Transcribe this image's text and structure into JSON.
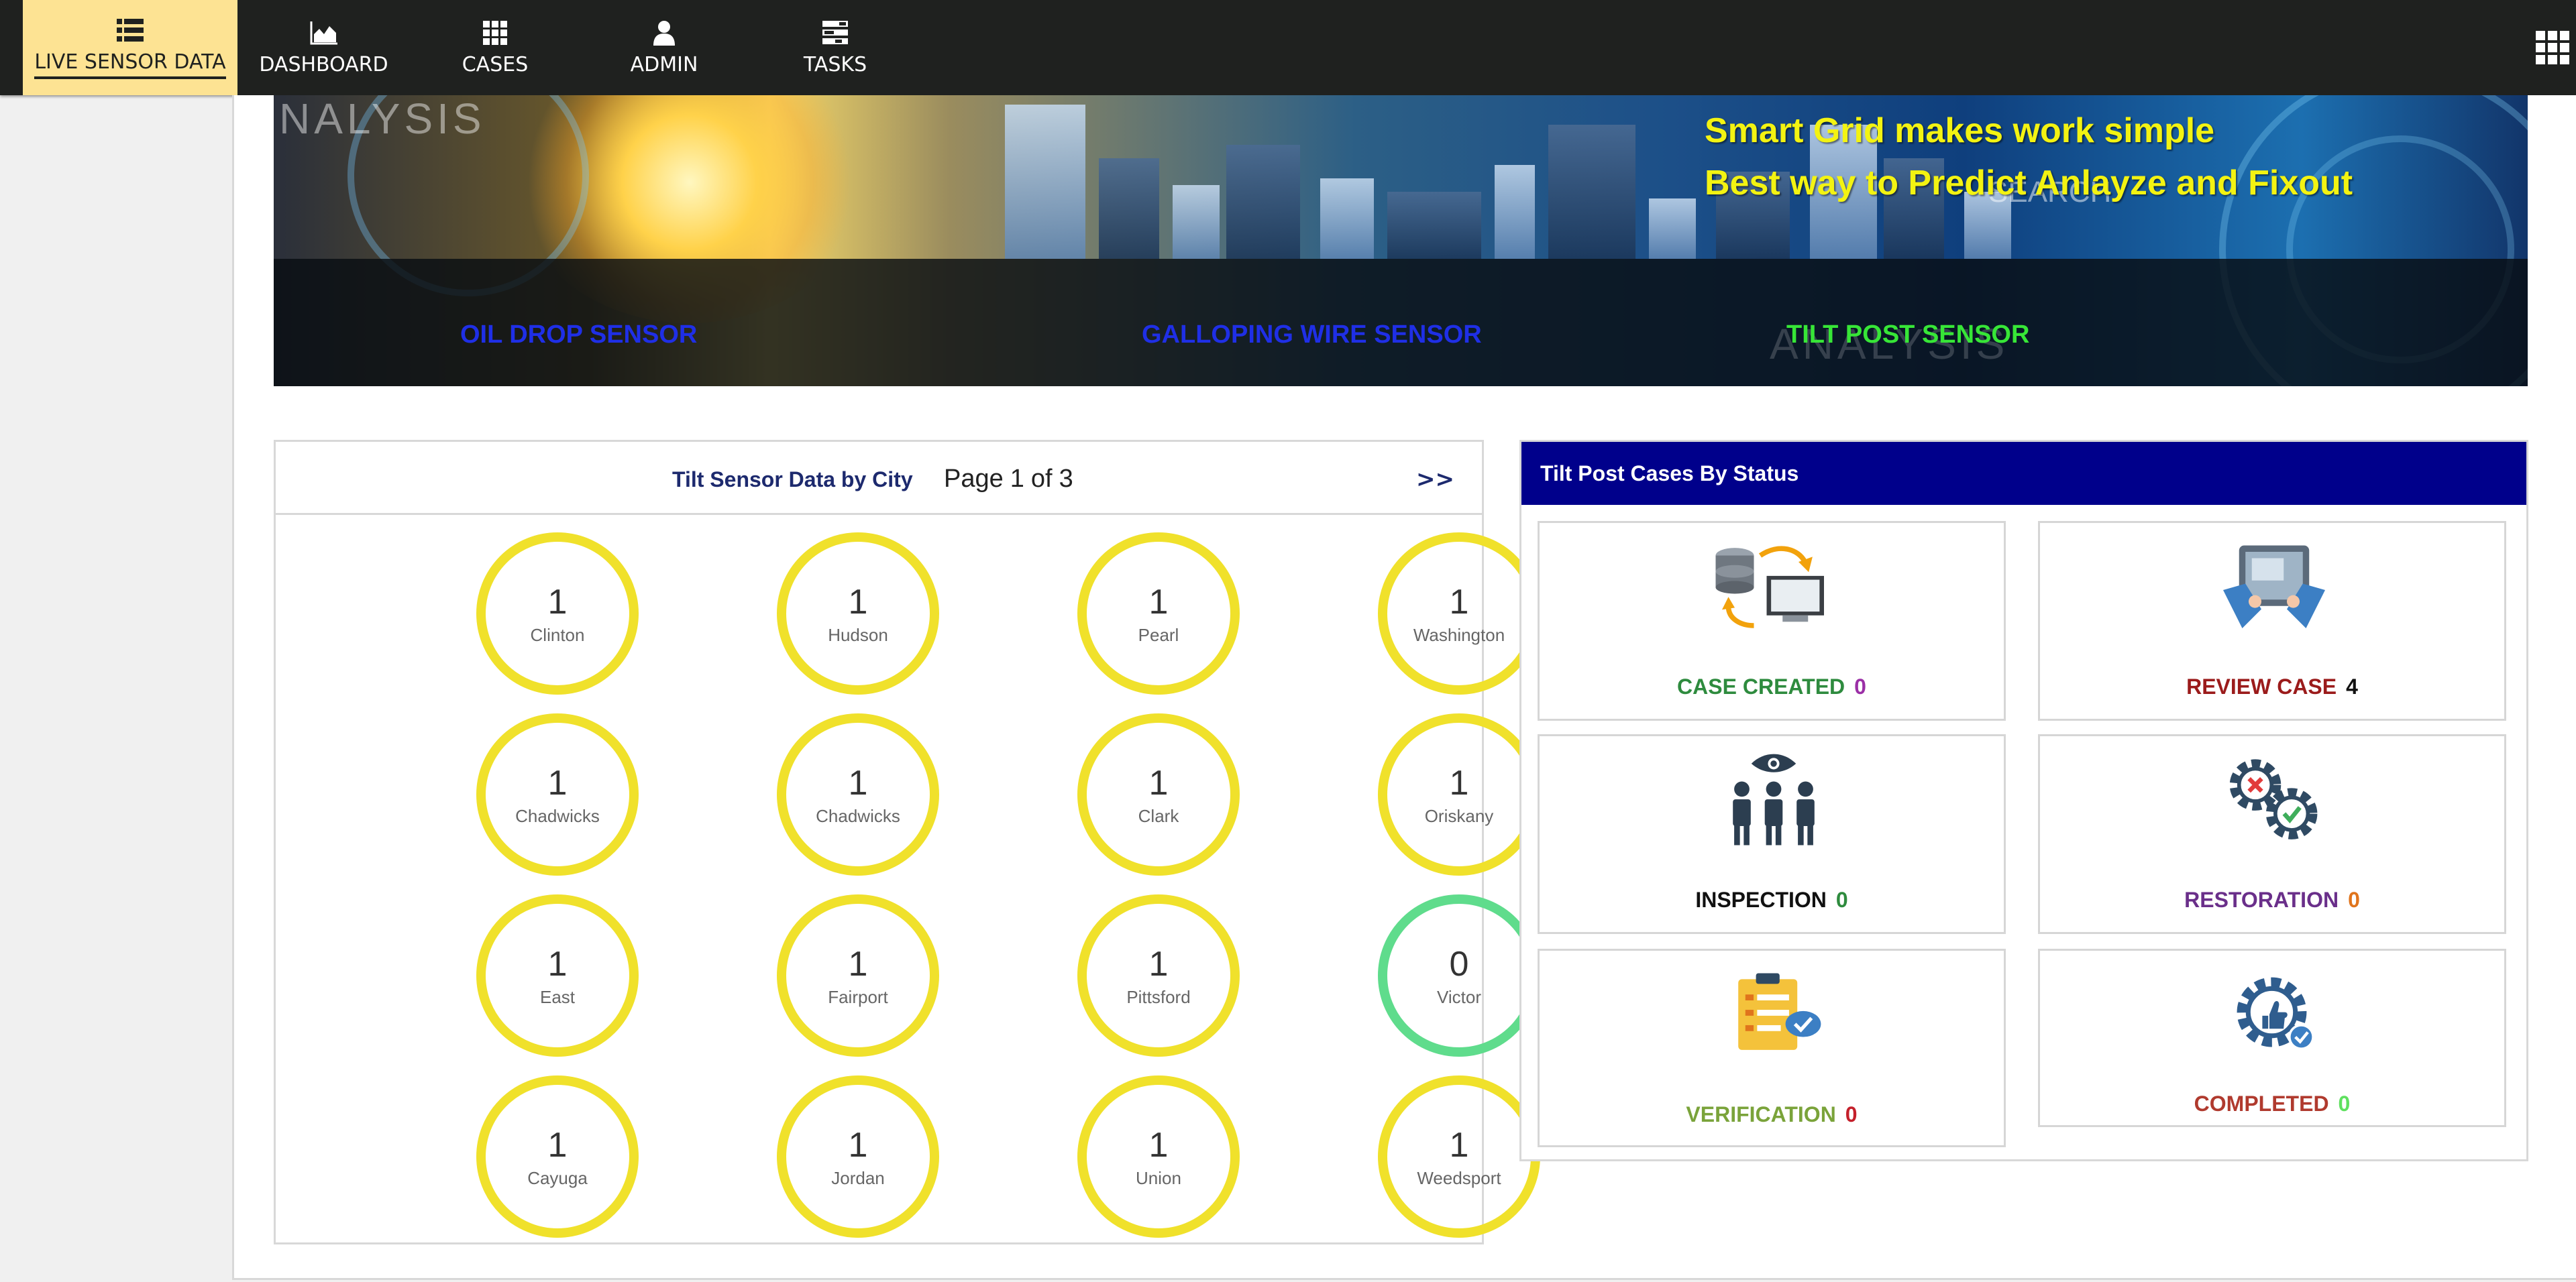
{
  "nav": {
    "items": [
      {
        "label": "LIVE SENSOR DATA"
      },
      {
        "label": "DASHBOARD"
      },
      {
        "label": "CASES"
      },
      {
        "label": "ADMIN"
      },
      {
        "label": "TASKS"
      }
    ]
  },
  "banner": {
    "faint_text": "NALYSIS",
    "tagline_1": "Smart Grid makes work simple",
    "tagline_2": "Best way to Predict Anlayze and Fixout",
    "search_ghost": "SEARCH",
    "strip_ghost": "ANALYSIS",
    "sensors": [
      {
        "label": "OIL DROP SENSOR",
        "color": "#1f2fe6"
      },
      {
        "label": "GALLOPING WIRE SENSOR",
        "color": "#1f2fe6"
      },
      {
        "label": "TILT POST SENSOR",
        "color": "#37e637"
      }
    ]
  },
  "city_panel": {
    "title": "Tilt Sensor Data by City",
    "page_word": "Page",
    "page_current": "1",
    "page_of": "of",
    "page_total": "3",
    "next_label": ">>",
    "cities": [
      {
        "count": "1",
        "name": "Clinton"
      },
      {
        "count": "1",
        "name": "Hudson"
      },
      {
        "count": "1",
        "name": "Pearl"
      },
      {
        "count": "1",
        "name": "Washington"
      },
      {
        "count": "1",
        "name": "Chadwicks"
      },
      {
        "count": "1",
        "name": "Chadwicks"
      },
      {
        "count": "1",
        "name": "Clark"
      },
      {
        "count": "1",
        "name": "Oriskany"
      },
      {
        "count": "1",
        "name": "East"
      },
      {
        "count": "1",
        "name": "Fairport"
      },
      {
        "count": "1",
        "name": "Pittsford"
      },
      {
        "count": "0",
        "name": "Victor"
      },
      {
        "count": "1",
        "name": "Cayuga"
      },
      {
        "count": "1",
        "name": "Jordan"
      },
      {
        "count": "1",
        "name": "Union"
      },
      {
        "count": "1",
        "name": "Weedsport"
      }
    ],
    "ring_color_active": "#f0e12b",
    "ring_color_zero": "#5fdc8c"
  },
  "status_panel": {
    "title": "Tilt Post Cases By Status",
    "header_color": "#00008b",
    "cards": [
      {
        "label": "CASE CREATED",
        "value": "0",
        "label_color": "#2e8b3e",
        "value_color": "#9b2fa6",
        "icon": "database-transfer-icon"
      },
      {
        "label": "REVIEW CASE",
        "value": "4",
        "label_color": "#9b1b1b",
        "value_color": "#111111",
        "icon": "tablet-review-icon"
      },
      {
        "label": "INSPECTION",
        "value": "0",
        "label_color": "#111111",
        "value_color": "#2e8b3e",
        "icon": "inspection-team-icon"
      },
      {
        "label": "RESTORATION",
        "value": "0",
        "label_color": "#6a2f8a",
        "value_color": "#e0741c",
        "icon": "gears-icon"
      },
      {
        "label": "VERIFICATION",
        "value": "0",
        "label_color": "#7aa33a",
        "value_color": "#c4202b",
        "icon": "clipboard-check-icon"
      },
      {
        "label": "COMPLETED",
        "value": "0",
        "label_color": "#b03a2e",
        "value_color": "#5fe05f",
        "icon": "gear-thumbs-up-icon"
      }
    ]
  }
}
